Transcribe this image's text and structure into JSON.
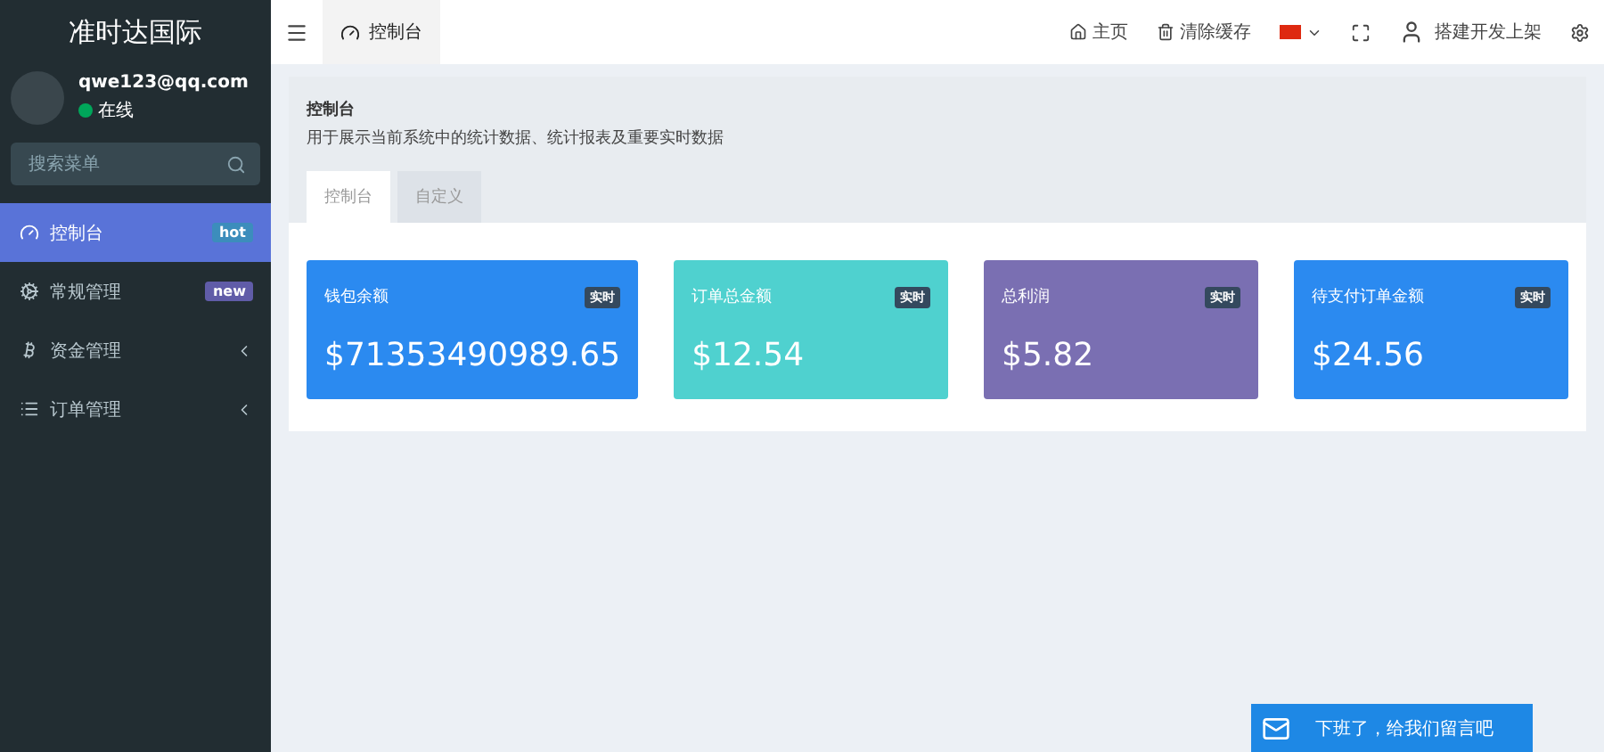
{
  "sidebar": {
    "brand": "准时达国际",
    "user": {
      "email": "qwe123@qq.com",
      "status": "在线"
    },
    "search": {
      "placeholder": "搜索菜单"
    },
    "items": [
      {
        "label": "控制台",
        "badge": "hot",
        "color": "#3c8dbc",
        "selected": true,
        "expandable": false
      },
      {
        "label": "常规管理",
        "badge": "new",
        "color": "#605ca8",
        "selected": false,
        "expandable": false
      },
      {
        "label": "资金管理",
        "selected": false,
        "expandable": true
      },
      {
        "label": "订单管理",
        "selected": false,
        "expandable": true
      }
    ]
  },
  "header": {
    "tabs": [
      {
        "label": "控制台",
        "selected": true
      }
    ],
    "actions": [
      {
        "kind": "home",
        "label": "主页"
      },
      {
        "kind": "trash",
        "label": "清除缓存"
      },
      {
        "kind": "flag"
      },
      {
        "kind": "fullscreen"
      },
      {
        "kind": "user",
        "label": "搭建开发上架"
      },
      {
        "kind": "settings"
      }
    ]
  },
  "panel": {
    "title": "控制台",
    "description": "用于展示当前系统中的统计数据、统计报表及重要实时数据",
    "tabs": [
      {
        "label": "控制台",
        "selected": true
      },
      {
        "label": "自定义",
        "selected": false
      }
    ],
    "cards": [
      {
        "title": "钱包余额",
        "tag": "实时",
        "value": "$71353490989.65",
        "color": "#2b8af0"
      },
      {
        "title": "订单总金额",
        "tag": "实时",
        "value": "$12.54",
        "color": "#4fd1cf"
      },
      {
        "title": "总利润",
        "tag": "实时",
        "value": "$5.82",
        "color": "#7a6fb2"
      },
      {
        "title": "待支付订单金额",
        "tag": "实时",
        "value": "$24.56",
        "color": "#2b8af0"
      }
    ]
  },
  "chat": {
    "label": "下班了，给我们留言吧"
  }
}
